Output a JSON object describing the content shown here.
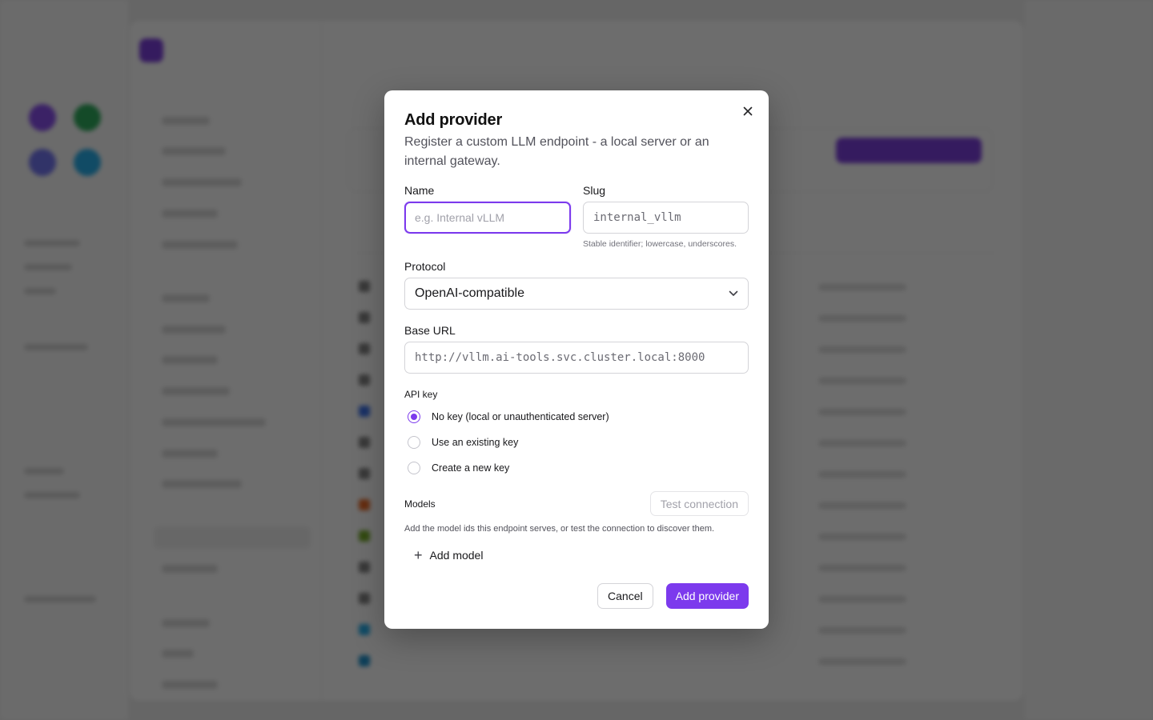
{
  "modal": {
    "title": "Add provider",
    "subtitle": "Register a custom LLM endpoint - a local server or an internal gateway.",
    "close_icon": "close-icon",
    "name_field": {
      "label": "Name",
      "placeholder": "e.g. Internal vLLM",
      "value": ""
    },
    "slug_field": {
      "label": "Slug",
      "placeholder": "internal_vllm",
      "hint": "Stable identifier; lowercase, underscores."
    },
    "protocol_field": {
      "label": "Protocol",
      "selected": "OpenAI-compatible"
    },
    "base_url_field": {
      "label": "Base URL",
      "placeholder": "http://vllm.ai-tools.svc.cluster.local:8000"
    },
    "api_key": {
      "label": "API key",
      "options": [
        {
          "label": "No key (local or unauthenticated server)",
          "selected": true
        },
        {
          "label": "Use an existing key",
          "selected": false
        },
        {
          "label": "Create a new key",
          "selected": false
        }
      ]
    },
    "models": {
      "label": "Models",
      "test_button": "Test connection",
      "description": "Add the model ids this endpoint serves, or test the connection to discover them.",
      "add_model": "Add model"
    },
    "footer": {
      "cancel": "Cancel",
      "submit": "Add provider"
    },
    "accent_color": "#7c3aed"
  }
}
